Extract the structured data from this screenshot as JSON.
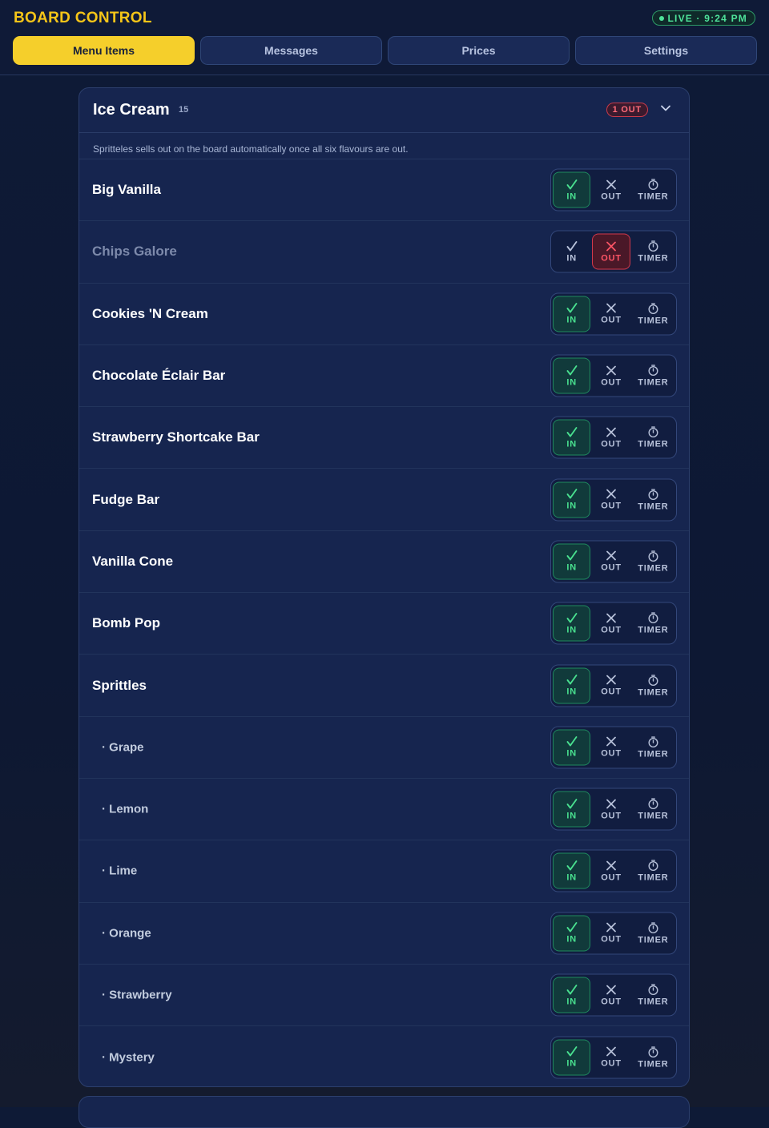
{
  "header": {
    "brand": "BOARD CONTROL",
    "live_badge": "LIVE · 9:24 PM",
    "colors": {
      "brand": "#f5c518",
      "live": "#4ee39a"
    }
  },
  "tabs": [
    {
      "label": "Menu Items",
      "active": true
    },
    {
      "label": "Messages",
      "active": false
    },
    {
      "label": "Prices",
      "active": false
    },
    {
      "label": "Settings",
      "active": false
    }
  ],
  "section": {
    "title": "Ice Cream",
    "count": "15",
    "out_badge": "1 OUT",
    "note": "Spritteles sells out on the board automatically once all six flavours are out.",
    "toggle_labels": {
      "in": "IN",
      "out": "OUT",
      "timer": "TIMER"
    },
    "icons": {
      "in": "check-icon",
      "out": "x-icon",
      "timer": "stopwatch-icon",
      "collapse": "chevron-down-icon"
    },
    "colors": {
      "in_active": "#49e08f",
      "out_active": "#ff5566"
    },
    "items": [
      {
        "name": "Big Vanilla",
        "status": "in",
        "sub": false
      },
      {
        "name": "Chips Galore",
        "status": "out",
        "sub": false
      },
      {
        "name": "Cookies 'N Cream",
        "status": "in",
        "sub": false
      },
      {
        "name": "Chocolate Éclair Bar",
        "status": "in",
        "sub": false
      },
      {
        "name": "Strawberry Shortcake Bar",
        "status": "in",
        "sub": false
      },
      {
        "name": "Fudge Bar",
        "status": "in",
        "sub": false
      },
      {
        "name": "Vanilla Cone",
        "status": "in",
        "sub": false
      },
      {
        "name": "Bomb Pop",
        "status": "in",
        "sub": false
      },
      {
        "name": "Sprittles",
        "status": "in",
        "sub": false
      },
      {
        "name": "Grape",
        "status": "in",
        "sub": true
      },
      {
        "name": "Lemon",
        "status": "in",
        "sub": true
      },
      {
        "name": "Lime",
        "status": "in",
        "sub": true
      },
      {
        "name": "Orange",
        "status": "in",
        "sub": true
      },
      {
        "name": "Strawberry",
        "status": "in",
        "sub": true
      },
      {
        "name": "Mystery",
        "status": "in",
        "sub": true
      }
    ]
  }
}
